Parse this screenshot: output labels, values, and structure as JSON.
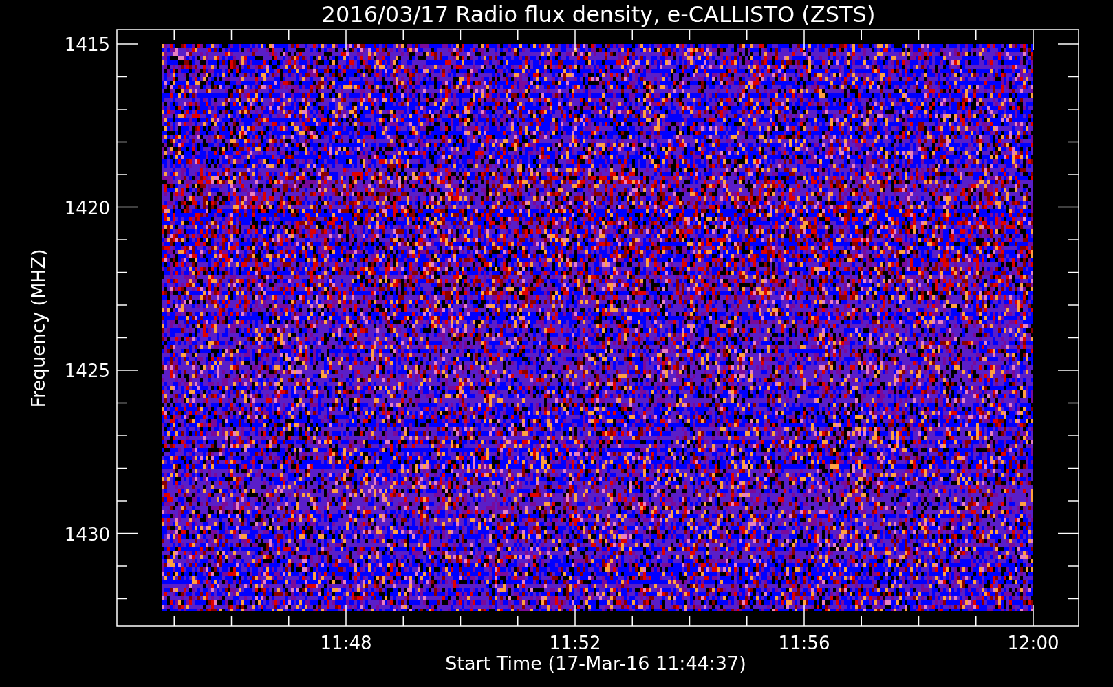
{
  "title": "2016/03/17  Radio flux density, e-CALLISTO (ZSTS)",
  "ylabel": "Frequency (MHZ)",
  "xlabel": "Start Time (17-Mar-16 11:44:37)",
  "yticks": [
    "1415",
    "1420",
    "1425",
    "1430"
  ],
  "xticks": [
    "11:48",
    "11:52",
    "11:56",
    "12:00"
  ]
}
